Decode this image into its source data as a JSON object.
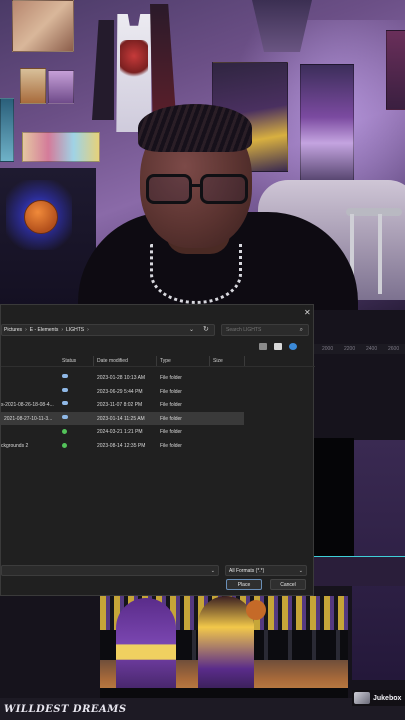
{
  "dialog": {
    "breadcrumb": [
      "Pictures",
      "E - Elements",
      "LIGHTS"
    ],
    "search_placeholder": "Search LIGHTS",
    "columns": [
      "Status",
      "Date modified",
      "Type",
      "Size"
    ],
    "rows": [
      {
        "name": "",
        "status": "cloud",
        "date": "2023-01-28 10:13 AM",
        "type": "File folder"
      },
      {
        "name": "",
        "status": "cloud",
        "date": "2023-06-29 5:44 PM",
        "type": "File folder"
      },
      {
        "name": "s-2021-08-26-18-08-4...",
        "status": "cloud",
        "date": "2023-11-07 8:02 PM",
        "type": "File folder"
      },
      {
        "name": "2021-08-27-10-11-3...",
        "status": "cloud",
        "date": "2023-01-14 11:25 AM",
        "type": "File folder",
        "selected": true
      },
      {
        "name": "",
        "status": "synced",
        "date": "2024-03-21 1:21 PM",
        "type": "File folder"
      },
      {
        "name": "ckgrounds 2",
        "status": "synced",
        "date": "2023-08-14 12:35 PM",
        "type": "File folder"
      }
    ],
    "filter": "All Formats (*.*)",
    "place_label": "Place",
    "cancel_label": "Cancel"
  },
  "timeline": {
    "ruler_ticks": [
      "2000",
      "2200",
      "2400",
      "2600"
    ]
  },
  "overlay": {
    "brand_text": "WILLDEST DREAMS",
    "badge_text": "Jukebox"
  },
  "colors": {
    "dialog_bg": "#202020",
    "accent_border": "#6a8fb8",
    "cloud_status": "#8fb8e6",
    "synced_status": "#53c35a"
  },
  "icons": {
    "close": "close-icon",
    "refresh": "refresh-icon",
    "search": "search-icon",
    "chevron": "chevron-down-icon"
  }
}
